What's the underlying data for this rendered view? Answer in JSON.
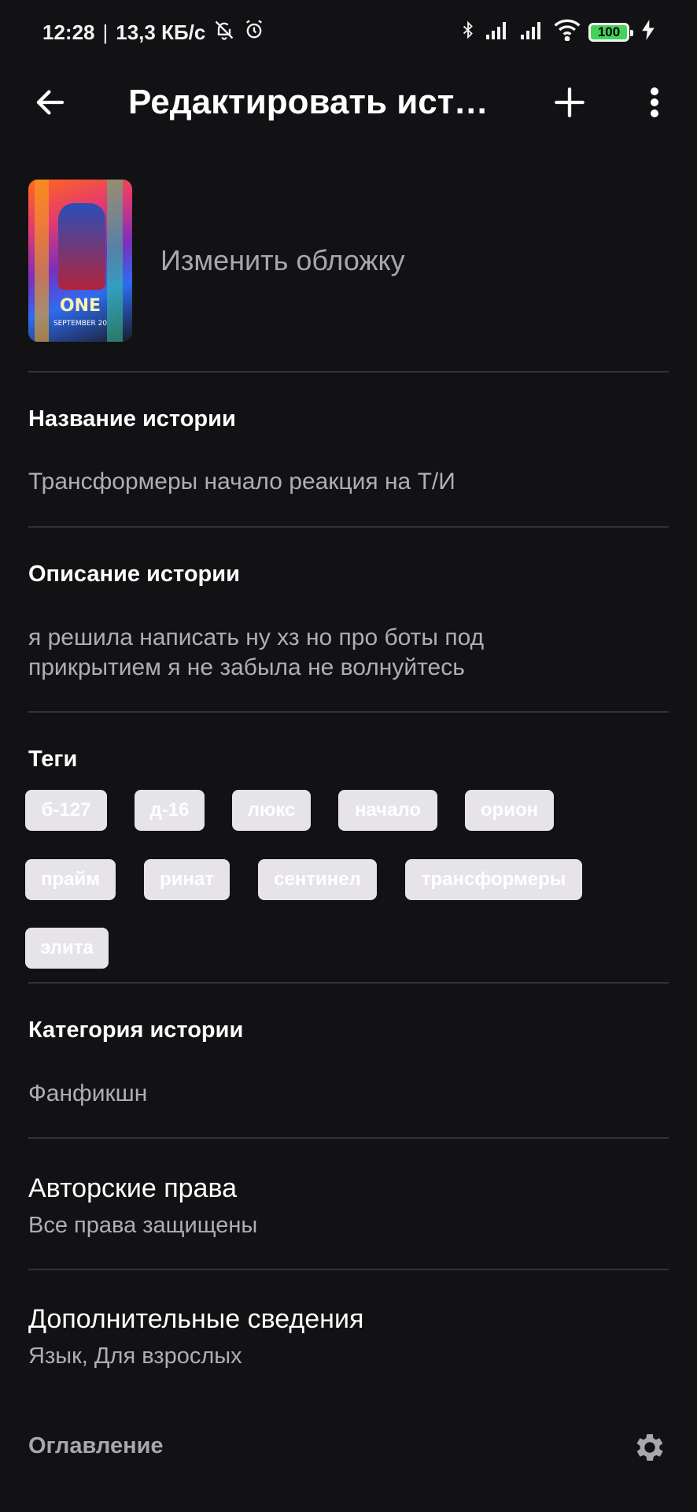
{
  "status_bar": {
    "time": "12:28",
    "speed": "13,3 КБ/с",
    "battery": "100"
  },
  "app_bar": {
    "title": "Редактировать исто..."
  },
  "cover": {
    "poster_logo": "ONE",
    "poster_caption": "SEPTEMBER 20",
    "change_label": "Изменить обложку"
  },
  "story_title": {
    "label": "Название истории",
    "value": "Трансформеры начало реакция на Т/И"
  },
  "story_description": {
    "label": "Описание истории",
    "value": "я решила написать ну хз но про боты под прикрытием я не забыла не волнуйтесь"
  },
  "tags": {
    "label": "Теги",
    "items": [
      "б-127",
      "д-16",
      "люкс",
      "начало",
      "орион",
      "прайм",
      "ринат",
      "сентинел",
      "трансформеры",
      "элита"
    ]
  },
  "category": {
    "label": "Категория истории",
    "value": "Фанфикшн"
  },
  "copyright": {
    "label": "Авторские права",
    "value": "Все права защищены"
  },
  "extra_info": {
    "label": "Дополнительные сведения",
    "value": "Язык, Для взрослых"
  },
  "toc": {
    "label": "Оглавление"
  },
  "icons": {
    "back": "arrow-left-icon",
    "add": "plus-icon",
    "more": "more-vertical-icon",
    "settings": "gear-icon"
  },
  "colors": {
    "background": "#121114",
    "divider": "#343236",
    "tag_bg": "#e6e4e8",
    "secondary_text": "#b0aeb2"
  }
}
